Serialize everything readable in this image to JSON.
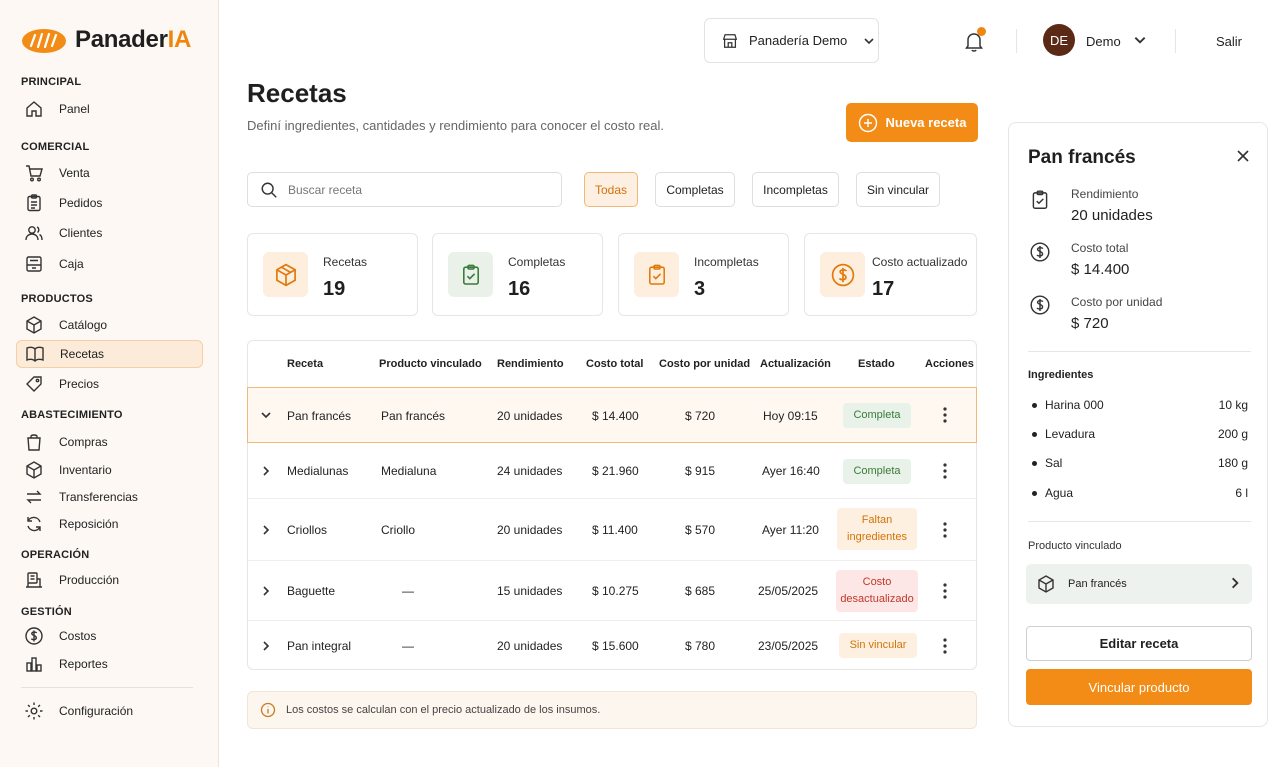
{
  "app": {
    "logo_main": "Panader",
    "logo_accent": "IA",
    "accent_color": "#f28c16"
  },
  "sidebar": {
    "sections": [
      {
        "title": "PRINCIPAL"
      },
      {
        "title": "COMERCIAL"
      },
      {
        "title": "PRODUCTOS"
      },
      {
        "title": "ABASTECIMIENTO"
      },
      {
        "title": "OPERACIÓN"
      },
      {
        "title": "GESTIÓN"
      }
    ],
    "items": [
      {
        "label": "Panel",
        "icon": "home-icon"
      },
      {
        "label": "Venta",
        "icon": "cart-icon"
      },
      {
        "label": "Pedidos",
        "icon": "clipboard-icon"
      },
      {
        "label": "Clientes",
        "icon": "users-icon"
      },
      {
        "label": "Caja",
        "icon": "register-icon"
      },
      {
        "label": "Catálogo",
        "icon": "box-icon"
      },
      {
        "label": "Recetas",
        "icon": "book-icon",
        "active": true
      },
      {
        "label": "Precios",
        "icon": "tag-icon"
      },
      {
        "label": "Compras",
        "icon": "bag-icon"
      },
      {
        "label": "Inventario",
        "icon": "box-icon"
      },
      {
        "label": "Transferencias",
        "icon": "swap-icon"
      },
      {
        "label": "Reposición",
        "icon": "refresh-icon"
      },
      {
        "label": "Producción",
        "icon": "factory-icon"
      },
      {
        "label": "Costos",
        "icon": "dollar-icon"
      },
      {
        "label": "Reportes",
        "icon": "bar-chart-icon"
      }
    ],
    "config_label": "Configuración"
  },
  "topbar": {
    "store": "Panadería Demo",
    "avatar_initials": "DE",
    "user": "Demo",
    "logout": "Salir"
  },
  "page": {
    "title": "Recetas",
    "subtitle": "Definí ingredientes, cantidades y rendimiento para conocer el costo real.",
    "new_button": "Nueva receta"
  },
  "search": {
    "placeholder": "Buscar receta",
    "value": ""
  },
  "filters": [
    {
      "label": "Todas",
      "active": true
    },
    {
      "label": "Completas"
    },
    {
      "label": "Incompletas"
    },
    {
      "label": "Sin vincular"
    }
  ],
  "stats": [
    {
      "label": "Recetas",
      "value": "19",
      "icon": "box-icon"
    },
    {
      "label": "Completas",
      "value": "16",
      "icon": "check-clipboard-icon"
    },
    {
      "label": "Incompletas",
      "value": "3",
      "icon": "check-clipboard-icon"
    },
    {
      "label": "Costo actualizado",
      "value": "17",
      "icon": "dollar-icon"
    }
  ],
  "table": {
    "columns": [
      "Receta",
      "Producto vinculado",
      "Rendimiento",
      "Costo total",
      "Costo por unidad",
      "Actualización",
      "Estado",
      "Acciones"
    ],
    "rows": [
      {
        "receta": "Pan francés",
        "producto": "Pan francés",
        "rendimiento": "20 unidades",
        "costo_total": "$ 14.400",
        "costo_unidad": "$ 720",
        "actualizacion": "Hoy 09:15",
        "estado": "Completa",
        "estado_tipo": "ok",
        "selected": true
      },
      {
        "receta": "Medialunas",
        "producto": "Medialuna",
        "rendimiento": "24 unidades",
        "costo_total": "$ 21.960",
        "costo_unidad": "$ 915",
        "actualizacion": "Ayer 16:40",
        "estado": "Completa",
        "estado_tipo": "ok"
      },
      {
        "receta": "Criollos",
        "producto": "Criollo",
        "rendimiento": "20 unidades",
        "costo_total": "$ 11.400",
        "costo_unidad": "$ 570",
        "actualizacion": "Ayer 11:20",
        "estado": "Faltan ingredientes",
        "estado_tipo": "warn"
      },
      {
        "receta": "Baguette",
        "producto": "—",
        "rendimiento": "15 unidades",
        "costo_total": "$ 10.275",
        "costo_unidad": "$ 685",
        "actualizacion": "25/05/2025",
        "estado": "Costo desactualizado",
        "estado_tipo": "err"
      },
      {
        "receta": "Pan integral",
        "producto": "—",
        "rendimiento": "20 unidades",
        "costo_total": "$ 15.600",
        "costo_unidad": "$ 780",
        "actualizacion": "23/05/2025",
        "estado": "Sin vincular",
        "estado_tipo": "pend"
      }
    ]
  },
  "note": "Los costos se calculan con el precio actualizado de los insumos.",
  "panel": {
    "title": "Pan francés",
    "info": [
      {
        "label": "Rendimiento",
        "value": "20 unidades",
        "icon": "check-clipboard-icon"
      },
      {
        "label": "Costo total",
        "value": "$ 14.400",
        "icon": "dollar-icon"
      },
      {
        "label": "Costo por unidad",
        "value": "$ 720",
        "icon": "dollar-icon"
      }
    ],
    "ingredients_title": "Ingredientes",
    "ingredients": [
      {
        "name": "Harina 000",
        "qty": "10 kg"
      },
      {
        "name": "Levadura",
        "qty": "200 g"
      },
      {
        "name": "Sal",
        "qty": "180 g"
      },
      {
        "name": "Agua",
        "qty": "6 l"
      }
    ],
    "linked_title": "Producto vinculado",
    "linked_product": "Pan francés",
    "edit_button": "Editar receta",
    "link_button": "Vincular producto"
  }
}
